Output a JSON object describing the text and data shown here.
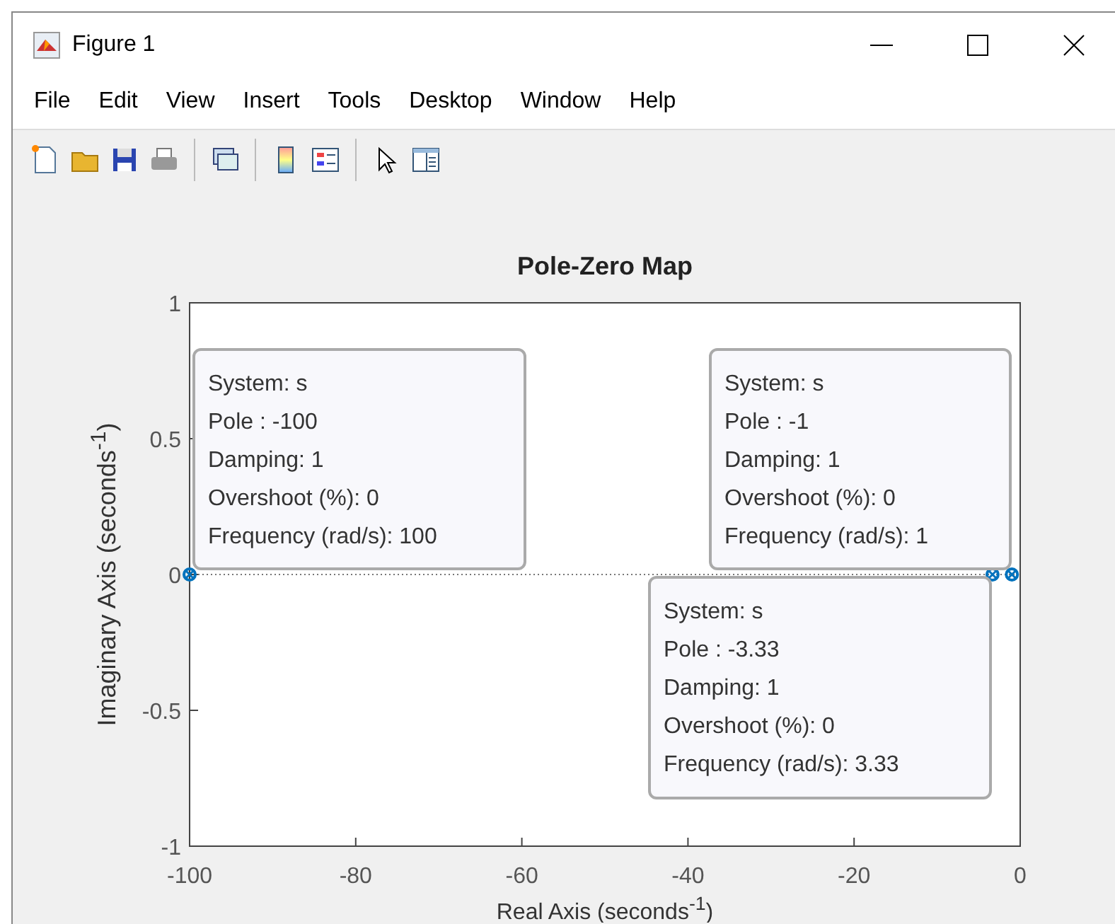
{
  "window": {
    "title": "Figure 1"
  },
  "menu": [
    {
      "label": "File"
    },
    {
      "label": "Edit"
    },
    {
      "label": "View"
    },
    {
      "label": "Insert"
    },
    {
      "label": "Tools"
    },
    {
      "label": "Desktop"
    },
    {
      "label": "Window"
    },
    {
      "label": "Help"
    }
  ],
  "toolbar": [
    {
      "kind": "new"
    },
    {
      "kind": "open"
    },
    {
      "kind": "save"
    },
    {
      "kind": "print"
    },
    {
      "kind": "separator"
    },
    {
      "kind": "link"
    },
    {
      "kind": "separator"
    },
    {
      "kind": "colorbar"
    },
    {
      "kind": "legend"
    },
    {
      "kind": "separator"
    },
    {
      "kind": "pointer"
    },
    {
      "kind": "inspector"
    }
  ],
  "plot": {
    "chart_data": {
      "type": "scatter",
      "title": "Pole-Zero Map",
      "xlabel": "Real Axis (seconds$^{-1}$)",
      "ylabel": "Imaginary Axis (seconds$^{-1}$)",
      "x": [
        -100,
        -3.33,
        -1
      ],
      "series": [
        {
          "color": "#0072bd",
          "values": [
            0,
            0,
            0
          ]
        }
      ],
      "xlim": [
        -100,
        0
      ],
      "ylim": [
        -1,
        1
      ],
      "xticks": [
        -100,
        -80,
        -60,
        -40,
        -20,
        0
      ],
      "yticks": [
        -1,
        -0.5,
        0,
        0.5,
        1
      ]
    },
    "datatips": [
      {
        "lines": [
          "System: s",
          "Pole : -100",
          "Damping: 1",
          "Overshoot (%): 0",
          "Frequency (rad/s): 100"
        ]
      },
      {
        "lines": [
          "System: s",
          "Pole : -1",
          "Damping: 1",
          "Overshoot (%): 0",
          "Frequency (rad/s): 1"
        ]
      },
      {
        "lines": [
          "System: s",
          "Pole : -3.33",
          "Damping: 1",
          "Overshoot (%): 0",
          "Frequency (rad/s): 3.33"
        ]
      }
    ]
  }
}
